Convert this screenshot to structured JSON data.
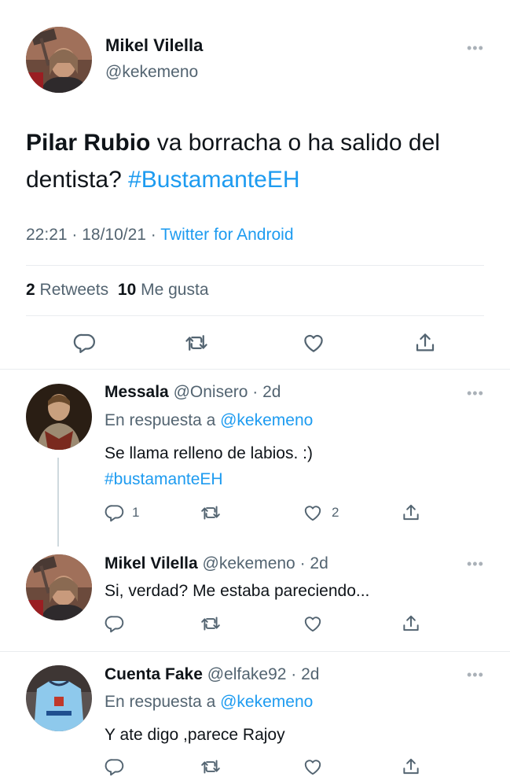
{
  "main_tweet": {
    "author_name": "Mikel Vilella",
    "author_handle": "@kekemeno",
    "text_mention": "Pilar Rubio",
    "text_body": " va borracha o ha salido del dentista? ",
    "text_hashtag": "#BustamanteEH",
    "time": "22:21 · 18/10/21 ·",
    "source": "Twitter for Android",
    "retweets_count": "2",
    "retweets_label": "Retweets",
    "likes_count": "10",
    "likes_label": "Me gusta"
  },
  "replies": [
    {
      "name": "Messala",
      "handle_time": "@Onisero · 2d",
      "reply_to_label": "En respuesta a",
      "reply_to_handle": "@kekemeno",
      "text": "Se llama relleno de labios. :)",
      "hashtag": "#bustamanteEH",
      "reply_count": "1",
      "like_count": "2"
    },
    {
      "name": "Mikel Vilella",
      "handle_time": "@kekemeno · 2d",
      "text": "Si, verdad? Me estaba pareciendo..."
    },
    {
      "name": "Cuenta Fake",
      "handle_time": "@elfake92 · 2d",
      "reply_to_label": "En respuesta a",
      "reply_to_handle": "@kekemeno",
      "text": "Y ate digo ,parece Rajoy"
    }
  ],
  "icons": [
    "more-icon",
    "reply-icon",
    "retweet-icon",
    "like-icon",
    "share-icon"
  ],
  "colors": {
    "link": "#1d9bf0",
    "muted": "#536471",
    "text": "#0f1419"
  }
}
